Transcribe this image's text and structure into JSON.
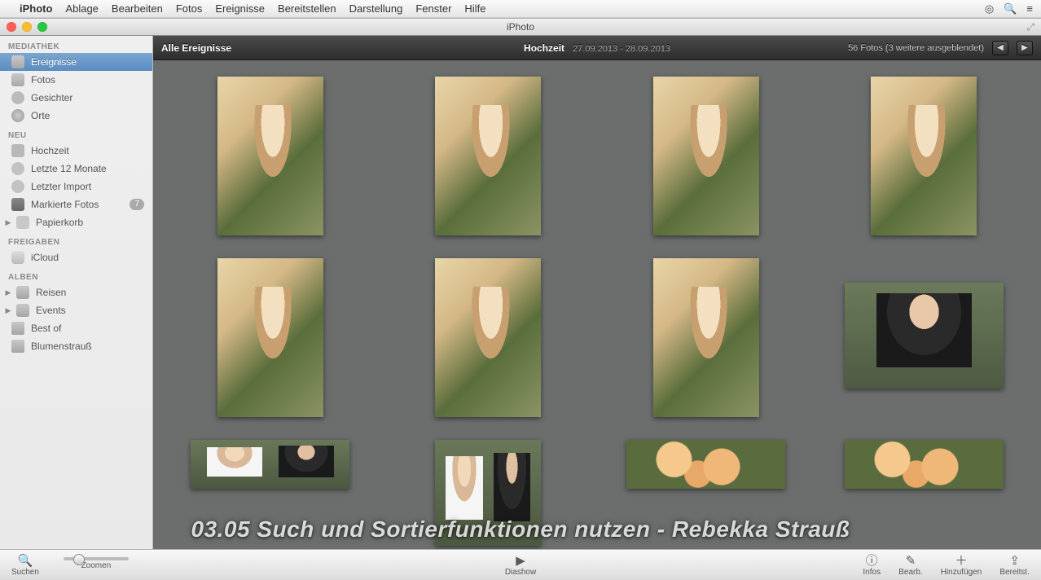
{
  "menubar": {
    "app": "iPhoto",
    "items": [
      "Ablage",
      "Bearbeiten",
      "Fotos",
      "Ereignisse",
      "Bereitstellen",
      "Darstellung",
      "Fenster",
      "Hilfe"
    ]
  },
  "window": {
    "title": "iPhoto"
  },
  "sidebar": {
    "sections": [
      {
        "header": "MEDIATHEK",
        "items": [
          {
            "icon": "stack",
            "label": "Ereignisse",
            "selected": true
          },
          {
            "icon": "stack",
            "label": "Fotos"
          },
          {
            "icon": "face",
            "label": "Gesichter"
          },
          {
            "icon": "globe",
            "label": "Orte"
          }
        ]
      },
      {
        "header": "NEU",
        "items": [
          {
            "icon": "palm",
            "label": "Hochzeit"
          },
          {
            "icon": "clock",
            "label": "Letzte 12 Monate"
          },
          {
            "icon": "clock",
            "label": "Letzter Import"
          },
          {
            "icon": "flag",
            "label": "Markierte Fotos",
            "badge": "7"
          },
          {
            "icon": "trash",
            "label": "Papierkorb",
            "disclosure": true
          }
        ]
      },
      {
        "header": "FREIGABEN",
        "items": [
          {
            "icon": "cloud",
            "label": "iCloud"
          }
        ]
      },
      {
        "header": "ALBEN",
        "items": [
          {
            "icon": "folder",
            "label": "Reisen",
            "disclosure": true
          },
          {
            "icon": "folder",
            "label": "Events",
            "disclosure": true
          },
          {
            "icon": "smart",
            "label": "Best of"
          },
          {
            "icon": "smart",
            "label": "Blumenstrauß"
          }
        ]
      }
    ]
  },
  "content_header": {
    "breadcrumb": "Alle Ereignisse",
    "event_title": "Hochzeit",
    "event_date": "27.09.2013 - 28.09.2013",
    "count_text": "56 Fotos (3 weitere ausgeblendet)"
  },
  "bottombar": {
    "search": "Suchen",
    "zoom": "Zoomen",
    "slideshow": "Diashow",
    "info": "Infos",
    "edit": "Bearb.",
    "add": "Hinzufügen",
    "share": "Bereitst."
  },
  "overlay_caption": "03.05 Such und Sortierfunktionen nutzen - Rebekka Strauß"
}
